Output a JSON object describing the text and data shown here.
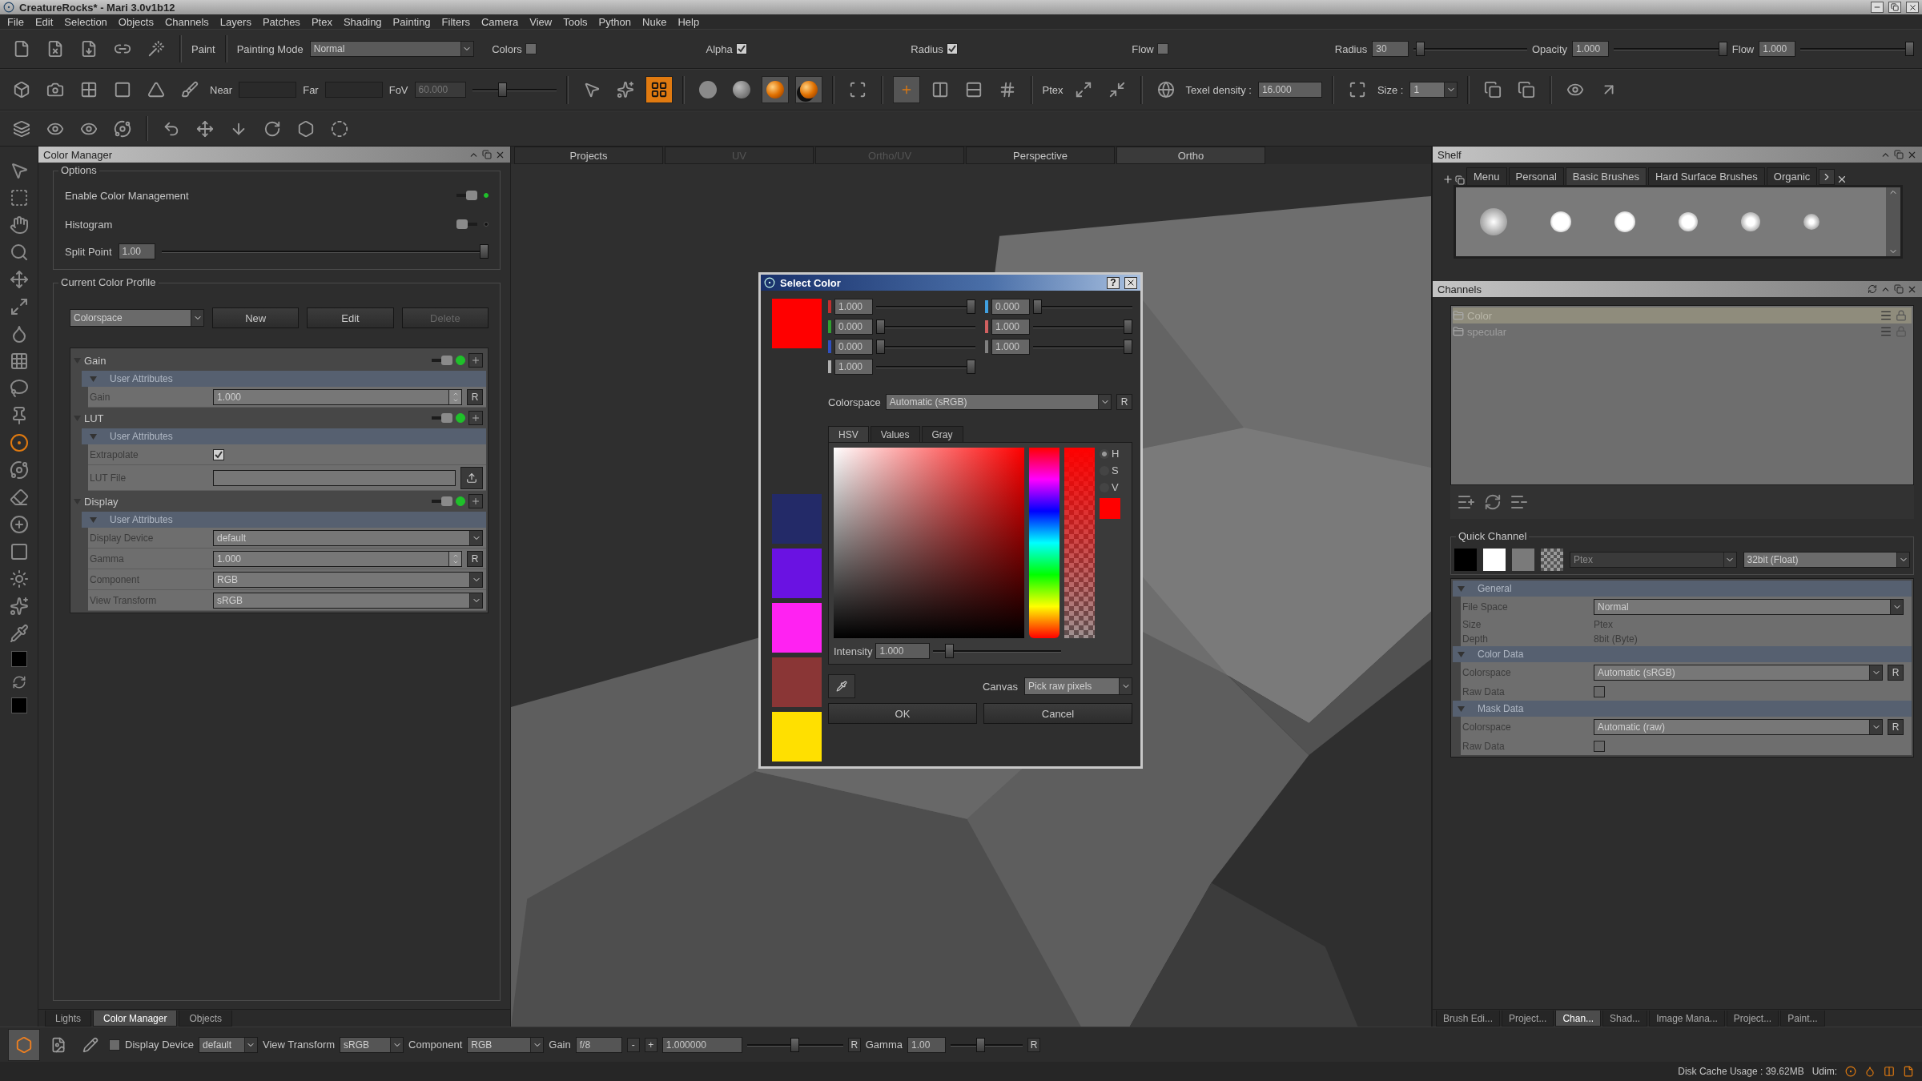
{
  "window": {
    "title": "CreatureRocks* - Mari 3.0v1b12"
  },
  "menu": [
    "File",
    "Edit",
    "Selection",
    "Objects",
    "Channels",
    "Layers",
    "Patches",
    "Ptex",
    "Shading",
    "Painting",
    "Filters",
    "Camera",
    "View",
    "Tools",
    "Python",
    "Nuke",
    "Help"
  ],
  "paint_toolbar": {
    "label": "Paint",
    "painting_mode": {
      "label": "Painting Mode",
      "value": "Normal"
    },
    "toggles": [
      {
        "label": "Colors",
        "checked": false
      },
      {
        "label": "Alpha",
        "checked": true
      },
      {
        "label": "Radius",
        "checked": true
      },
      {
        "label": "Flow",
        "checked": false
      }
    ],
    "sliders": [
      {
        "label": "Radius",
        "value": "30",
        "level": 0.02
      },
      {
        "label": "Opacity",
        "value": "1.000",
        "level": 1
      },
      {
        "label": "Flow",
        "value": "1.000",
        "level": 1
      }
    ]
  },
  "view_toolbar": {
    "near_label": "Near",
    "far_label": "Far",
    "fov": {
      "label": "FoV",
      "value": "60.000",
      "level": 0.35
    },
    "mode_buttons": [
      {
        "kind": "cursor",
        "selected": false
      },
      {
        "kind": "burst",
        "selected": false
      },
      {
        "kind": "paint_through",
        "selected": true
      }
    ],
    "shading_buttons": [
      {
        "kind": "flat",
        "selected": false
      },
      {
        "kind": "smooth",
        "selected": false
      },
      {
        "kind": "lit",
        "selected": true
      },
      {
        "kind": "shadow",
        "selected": true
      }
    ],
    "ptex_label": "Ptex",
    "texel_density": {
      "label": "Texel density :",
      "value": "16.000"
    },
    "size": {
      "label": "Size :",
      "value": "1"
    }
  },
  "color_manager": {
    "title": "Color Manager",
    "options": {
      "title": "Options",
      "toggles": [
        {
          "label": "Enable Color Management",
          "on": true
        },
        {
          "label": "Histogram",
          "on": false
        }
      ],
      "split_point": {
        "label": "Split Point",
        "value": "1.00",
        "level": 1
      }
    },
    "profile": {
      "title": "Current Color Profile",
      "selector": "Colorspace",
      "buttons": [
        {
          "label": "New",
          "disabled": false
        },
        {
          "label": "Edit",
          "disabled": false
        },
        {
          "label": "Delete",
          "disabled": true
        }
      ],
      "sections": [
        {
          "name": "Gain",
          "enabled": true,
          "group": "User Attributes",
          "rows": [
            {
              "kind": "spin",
              "label": "Gain",
              "value": "1.000",
              "reset": "R"
            }
          ]
        },
        {
          "name": "LUT",
          "enabled": true,
          "group": "User Attributes",
          "rows": [
            {
              "kind": "checkbox",
              "label": "Extrapolate",
              "checked": true
            },
            {
              "kind": "file",
              "label": "LUT File"
            }
          ]
        },
        {
          "name": "Display",
          "enabled": true,
          "group": "User Attributes",
          "rows": [
            {
              "kind": "dropdown",
              "label": "Display Device",
              "value": "default"
            },
            {
              "kind": "spin",
              "label": "Gamma",
              "value": "1.000",
              "reset": "R"
            },
            {
              "kind": "dropdown",
              "label": "Component",
              "value": "RGB"
            },
            {
              "kind": "dropdown",
              "label": "View Transform",
              "value": "sRGB"
            }
          ]
        }
      ]
    },
    "tabs": [
      {
        "label": "Lights",
        "selected": false
      },
      {
        "label": "Color Manager",
        "selected": true
      },
      {
        "label": "Objects",
        "selected": false
      }
    ]
  },
  "viewport": {
    "tabs": [
      {
        "label": "Projects",
        "selected": false,
        "disabled": false
      },
      {
        "label": "UV",
        "selected": false,
        "disabled": true
      },
      {
        "label": "Ortho/UV",
        "selected": false,
        "disabled": true
      },
      {
        "label": "Perspective",
        "selected": false,
        "disabled": false
      },
      {
        "label": "Ortho",
        "selected": true,
        "disabled": false
      }
    ]
  },
  "select_color": {
    "title": "Select Color",
    "help": "?",
    "current_swatch": {
      "color": "#ff0000"
    },
    "sliders_left": [
      {
        "value": "1.000",
        "level": 1,
        "color": "#c03030"
      },
      {
        "value": "0.000",
        "level": 0,
        "color": "#30a030"
      },
      {
        "value": "0.000",
        "level": 0,
        "color": "#3050c0"
      },
      {
        "value": "1.000",
        "level": 1,
        "color": "#b0b0b0"
      }
    ],
    "sliders_right": [
      {
        "value": "0.000",
        "level": 0,
        "color": "#40a0e0"
      },
      {
        "value": "1.000",
        "level": 1,
        "color": "#d06060"
      },
      {
        "value": "1.000",
        "level": 1,
        "color": "#808080"
      }
    ],
    "colorspace": {
      "label": "Colorspace",
      "value": "Automatic (sRGB)",
      "reset": "R"
    },
    "tabs": [
      {
        "label": "HSV",
        "selected": true
      },
      {
        "label": "Values",
        "selected": false
      },
      {
        "label": "Gray",
        "selected": false
      }
    ],
    "channels": [
      {
        "label": "H",
        "selected": true
      },
      {
        "label": "S",
        "selected": false
      },
      {
        "label": "V",
        "selected": false
      }
    ],
    "intensity": {
      "label": "Intensity",
      "value": "1.000",
      "level": 0.1
    },
    "canvas": {
      "label": "Canvas",
      "value": "Pick raw pixels"
    },
    "buttons": [
      "OK",
      "Cancel"
    ],
    "history": [
      {
        "color": "#232a68"
      },
      {
        "color": "#6a12e2"
      },
      {
        "color": "#ff22f2"
      },
      {
        "color": "#8a3636"
      },
      {
        "color": "#ffe000"
      }
    ]
  },
  "shelf": {
    "title": "Shelf",
    "tabs": [
      {
        "label": "Menu",
        "selected": false
      },
      {
        "label": "Personal",
        "selected": false
      },
      {
        "label": "Basic Brushes",
        "selected": true
      },
      {
        "label": "Hard Surface Brushes",
        "selected": false
      },
      {
        "label": "Organic",
        "selected": false
      }
    ]
  },
  "channels_panel": {
    "title": "Channels",
    "items": [
      {
        "name": "Color",
        "selected": true
      },
      {
        "name": "specular",
        "selected": false
      }
    ],
    "quick_channel": {
      "label": "Quick Channel",
      "format": "Ptex",
      "format_disabled": true,
      "depth": "32bit (Float)"
    },
    "properties": [
      {
        "group": "General",
        "rows": [
          {
            "kind": "dropdown",
            "label": "File Space",
            "value": "Normal"
          },
          {
            "kind": "text",
            "label": "Size",
            "value": "Ptex"
          },
          {
            "kind": "text",
            "label": "Depth",
            "value": "8bit  (Byte)"
          }
        ]
      },
      {
        "group": "Color Data",
        "rows": [
          {
            "kind": "dropdown",
            "label": "Colorspace",
            "value": "Automatic (sRGB)",
            "reset": "R"
          },
          {
            "kind": "checkbox",
            "label": "Raw Data",
            "checked": false
          }
        ]
      },
      {
        "group": "Mask Data",
        "rows": [
          {
            "kind": "dropdown",
            "label": "Colorspace",
            "value": "Automatic (raw)",
            "reset": "R"
          },
          {
            "kind": "checkbox",
            "label": "Raw Data",
            "checked": false
          }
        ]
      }
    ]
  },
  "right_tabs": [
    {
      "label": "Brush Edi...",
      "selected": false
    },
    {
      "label": "Project...",
      "selected": false
    },
    {
      "label": "Chan...",
      "selected": true
    },
    {
      "label": "Shad...",
      "selected": false
    },
    {
      "label": "Image Mana...",
      "selected": false
    },
    {
      "label": "Project...",
      "selected": false
    },
    {
      "label": "Paint...",
      "selected": false
    }
  ],
  "display_bar": {
    "lock_checked": false,
    "display_device": {
      "label": "Display Device",
      "value": "default"
    },
    "view_transform": {
      "label": "View Transform",
      "value": "sRGB"
    },
    "component": {
      "label": "Component",
      "value": "RGB"
    },
    "gain": {
      "label": "Gain",
      "value": "f/8",
      "minus": "-",
      "plus": "+",
      "exposure": "1.000000",
      "level": 0.5,
      "reset": "R"
    },
    "gamma": {
      "label": "Gamma",
      "value": "1.00",
      "level": 0.4,
      "reset": "R"
    }
  },
  "status_bar": {
    "disk_cache": "Disk Cache Usage : 39.62MB",
    "udim_label": "Udim:"
  }
}
